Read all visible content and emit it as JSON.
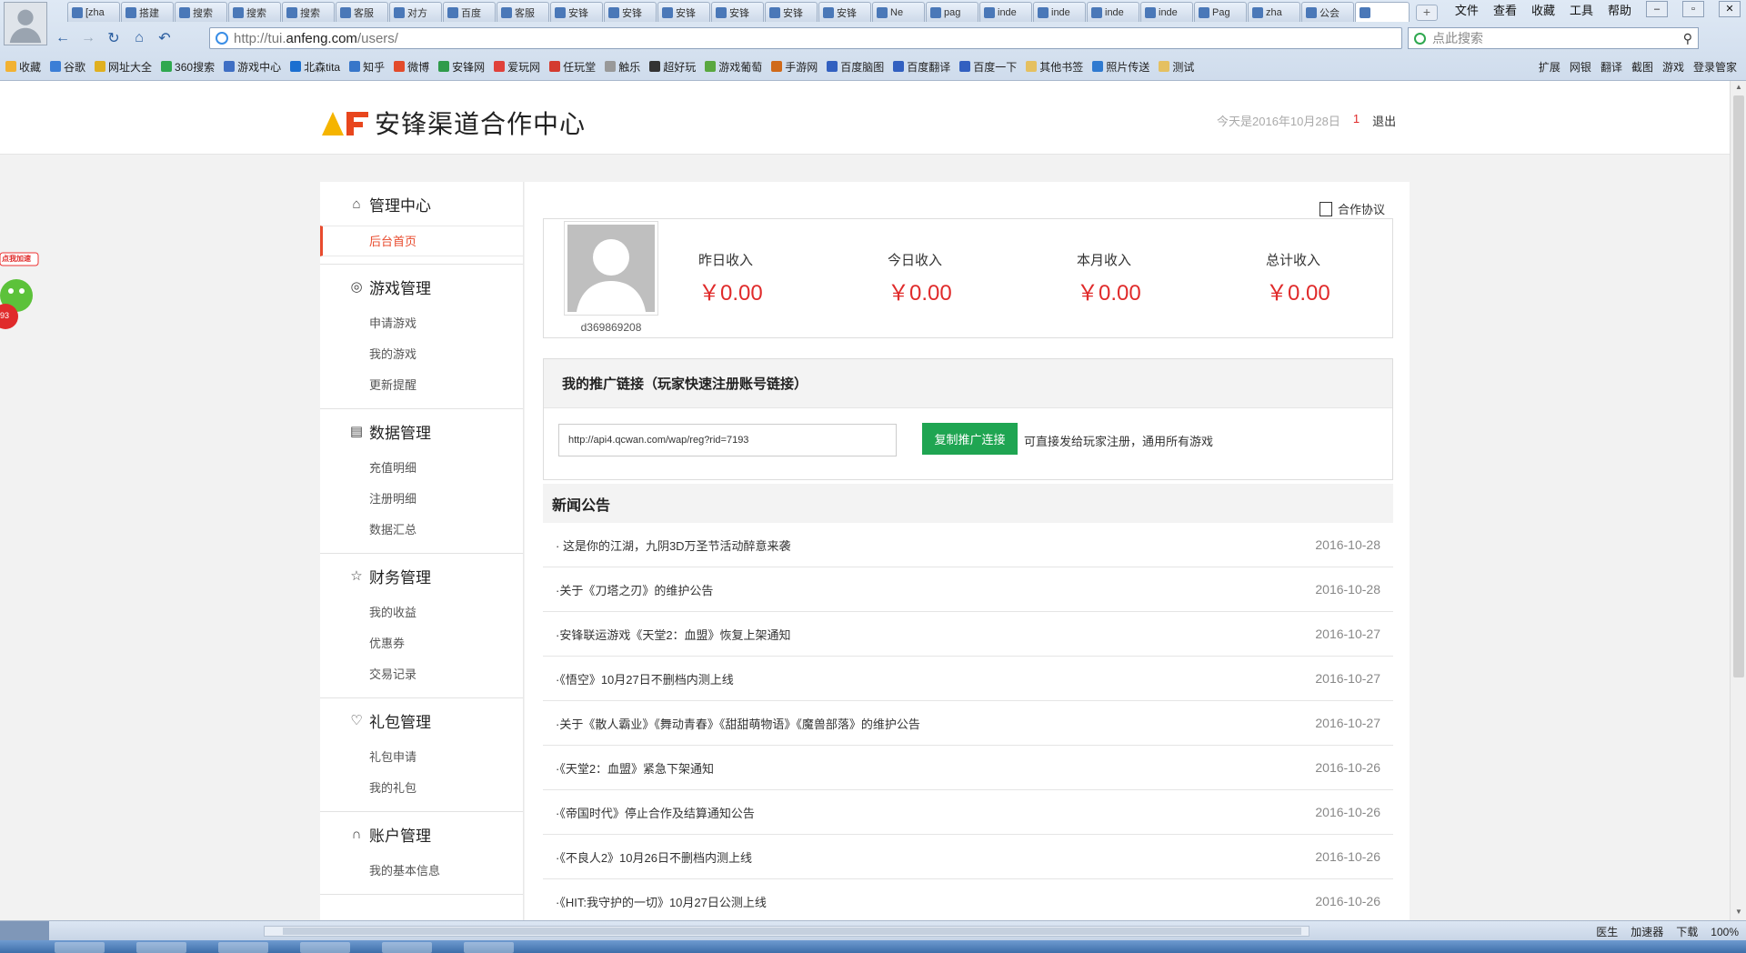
{
  "browser": {
    "tabs": [
      "[zha",
      "搭建",
      "搜索",
      "搜索",
      "搜索",
      "客服",
      "对方",
      "百度",
      "客服",
      "安锋",
      "安锋",
      "安锋",
      "安锋",
      "安锋",
      "安锋",
      "Ne",
      "pag",
      "inde",
      "inde",
      "inde",
      "inde",
      "Pag",
      "zha",
      "公会",
      ""
    ],
    "menu": [
      "文件",
      "查看",
      "收藏",
      "工具",
      "帮助"
    ],
    "address_host": "http://tui.",
    "address_domain": "anfeng.com",
    "address_path": "/users/",
    "search_placeholder": "点此搜索",
    "bookmarks": [
      "收藏",
      "谷歌",
      "网址大全",
      "360搜索",
      "游戏中心",
      "北森tita",
      "知乎",
      "微博",
      "安锋网",
      "爱玩网",
      "任玩堂",
      "触乐",
      "超好玩",
      "游戏葡萄",
      "手游网",
      "百度脑图",
      "百度翻译",
      "百度一下",
      "其他书签",
      "照片传送",
      "测试"
    ],
    "toolbar_right": [
      "扩展",
      "网银",
      "翻译",
      "截图",
      "游戏",
      "登录管家"
    ],
    "status_items": [
      "医生",
      "加速器",
      "下载",
      "100%"
    ]
  },
  "header": {
    "title": "安锋渠道合作中心",
    "date_text": "今天是2016年10月28日",
    "count": "1",
    "logout": "退出"
  },
  "sidebar": {
    "sections": [
      {
        "title": "管理中心",
        "icon": "home-icon",
        "items": [
          "后台首页"
        ]
      },
      {
        "title": "游戏管理",
        "icon": "gamepad-icon",
        "items": [
          "申请游戏",
          "我的游戏",
          "更新提醒"
        ]
      },
      {
        "title": "数据管理",
        "icon": "book-icon",
        "items": [
          "充值明细",
          "注册明细",
          "数据汇总"
        ]
      },
      {
        "title": "财务管理",
        "icon": "star-icon",
        "items": [
          "我的收益",
          "优惠券",
          "交易记录"
        ]
      },
      {
        "title": "礼包管理",
        "icon": "heart-icon",
        "items": [
          "礼包申请",
          "我的礼包"
        ]
      },
      {
        "title": "账户管理",
        "icon": "headset-icon",
        "items": [
          "我的基本信息"
        ]
      }
    ]
  },
  "main": {
    "contract": "合作协议",
    "username": "d369869208",
    "stats": [
      {
        "label": "昨日收入",
        "value": "￥0.00"
      },
      {
        "label": "今日收入",
        "value": "￥0.00"
      },
      {
        "label": "本月收入",
        "value": "￥0.00"
      },
      {
        "label": "总计收入",
        "value": "￥0.00"
      }
    ],
    "promo_title": "我的推广链接（玩家快速注册账号链接）",
    "promo_link": "http://api4.qcwan.com/wap/reg?rid=7193",
    "copy_button": "复制推广连接",
    "promo_note": "可直接发给玩家注册，通用所有游戏",
    "news_title": "新闻公告",
    "news": [
      {
        "title": "· 这是你的江湖，九阴3D万圣节活动醉意来袭",
        "date": "2016-10-28"
      },
      {
        "title": "·关于《刀塔之刃》的维护公告",
        "date": "2016-10-28"
      },
      {
        "title": "·安锋联运游戏《天堂2：血盟》恢复上架通知",
        "date": "2016-10-27"
      },
      {
        "title": "·《悟空》10月27日不删档内测上线",
        "date": "2016-10-27"
      },
      {
        "title": "·关于《散人霸业》《舞动青春》《甜甜萌物语》《魔兽部落》的维护公告",
        "date": "2016-10-27"
      },
      {
        "title": "·《天堂2：血盟》紧急下架通知",
        "date": "2016-10-26"
      },
      {
        "title": "·《帝国时代》停止合作及结算通知公告",
        "date": "2016-10-26"
      },
      {
        "title": "·《不良人2》10月26日不删档内测上线",
        "date": "2016-10-26"
      },
      {
        "title": "·《HIT:我守护的一切》10月27日公测上线",
        "date": "2016-10-26"
      }
    ]
  },
  "widget": {
    "label": "点我加速",
    "badge": "93"
  },
  "colors": {
    "accent": "#e84b2e",
    "money": "#e02b2b",
    "button": "#1fa552"
  }
}
